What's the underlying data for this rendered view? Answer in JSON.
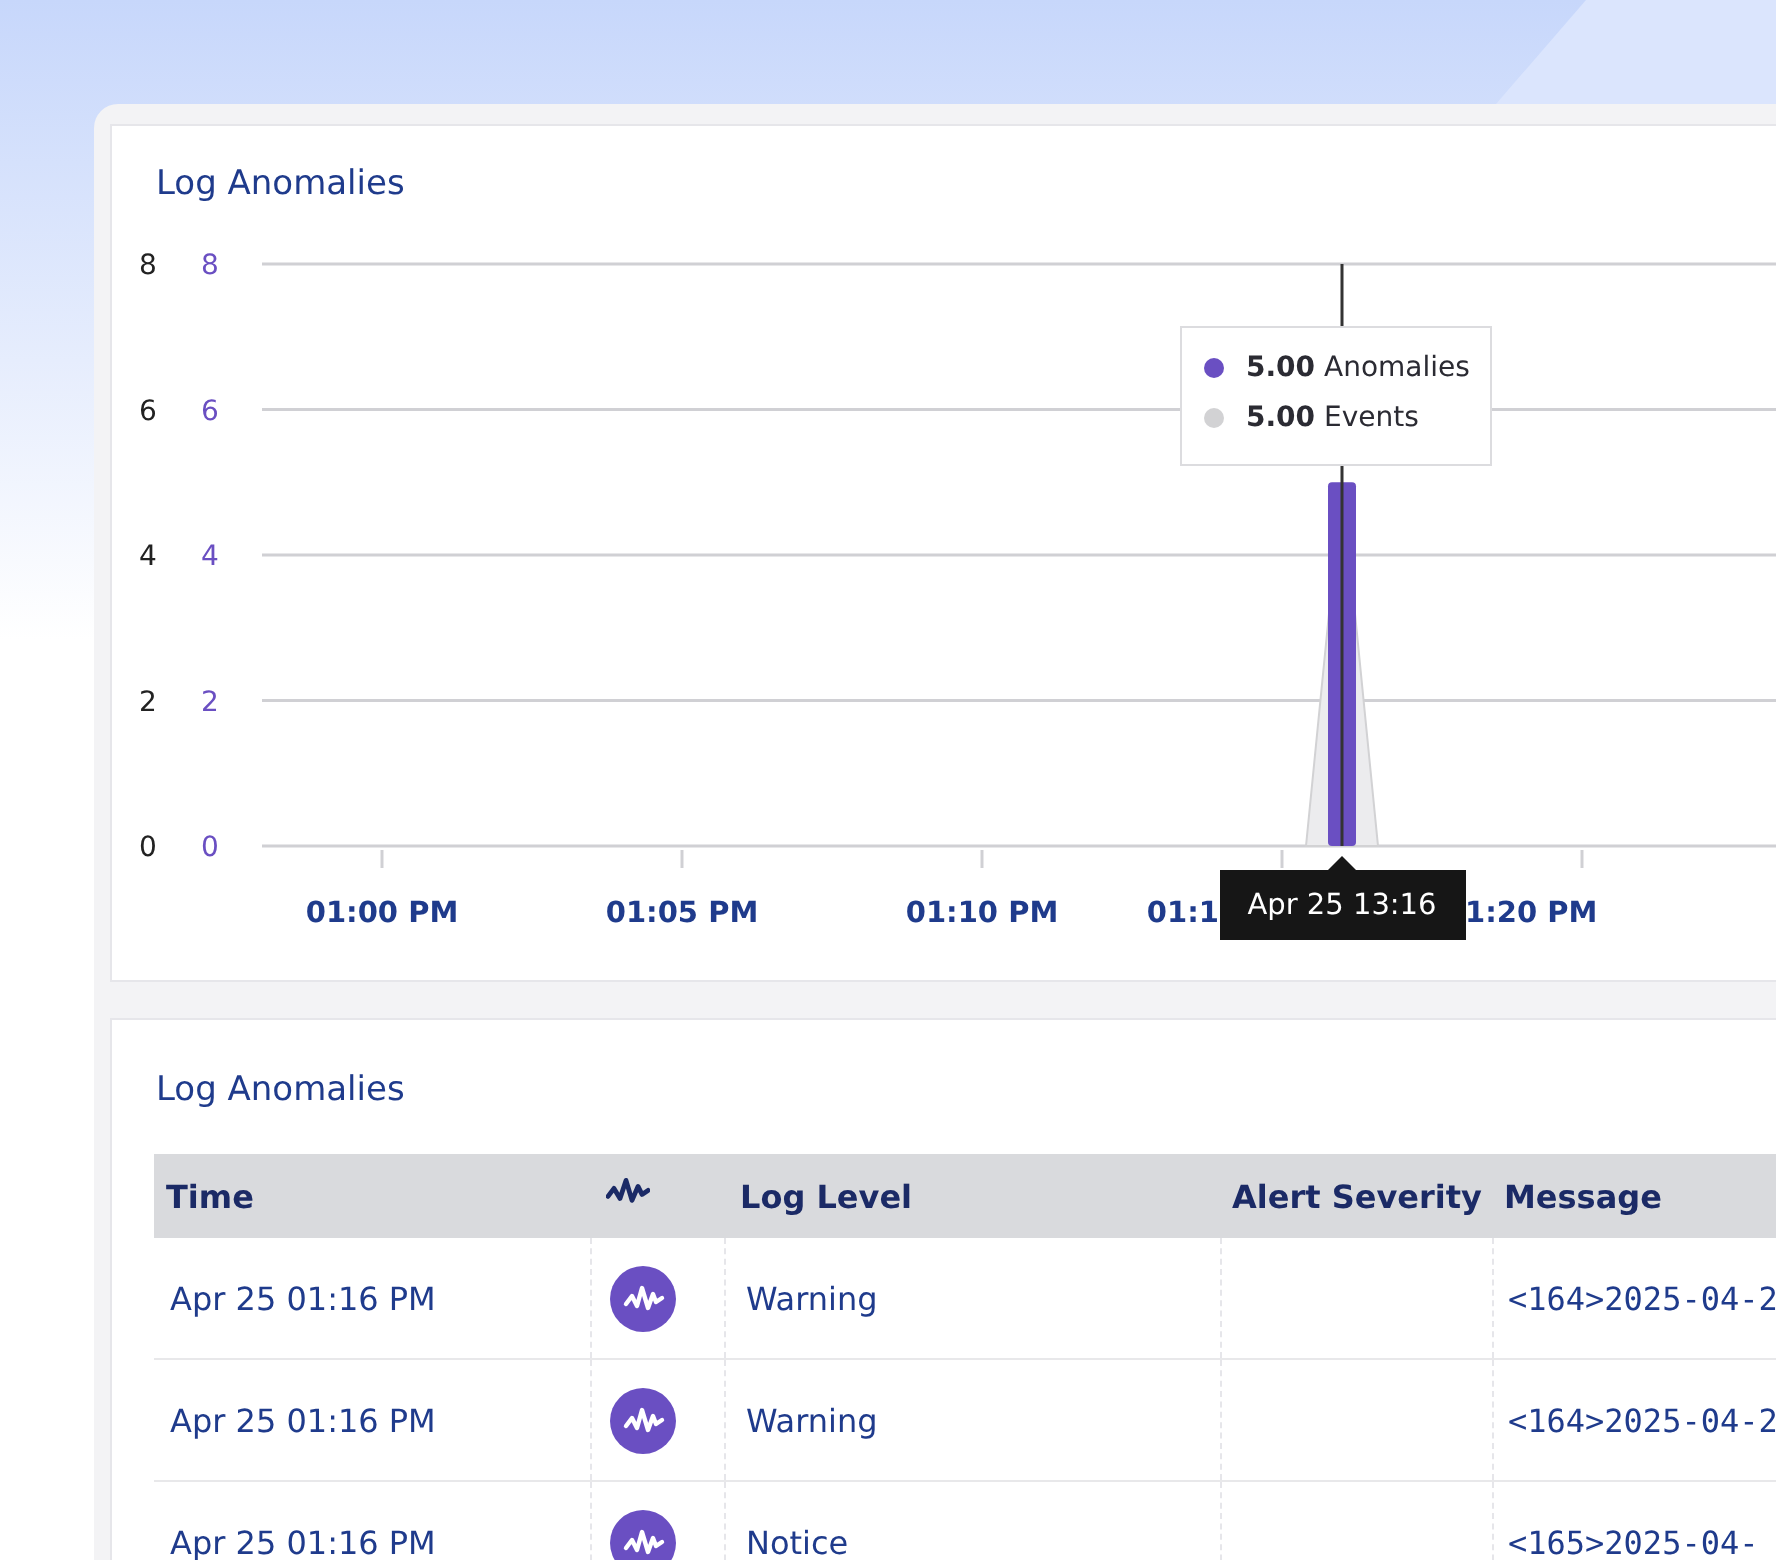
{
  "chart_panel": {
    "title": "Log Anomalies",
    "chart_data": {
      "type": "bar",
      "categories": [
        null,
        null,
        "01:00 PM",
        null,
        null,
        null,
        null,
        "01:05 PM",
        null,
        null,
        null,
        null,
        "01:10 PM",
        null,
        null,
        null,
        null,
        null,
        null,
        null,
        null,
        null,
        null,
        null,
        null,
        null
      ],
      "series": [
        {
          "name": "Anomalies",
          "color": "#6a4fc2",
          "values": [
            null,
            null,
            null,
            null,
            null,
            null,
            null,
            null,
            null,
            null,
            null,
            null,
            null,
            null,
            null,
            null,
            null,
            null,
            5,
            null,
            null,
            null,
            null,
            null,
            null,
            null
          ]
        }
      ],
      "ylim": [
        0,
        8
      ],
      "yticks": [
        0,
        2,
        4,
        6,
        8
      ],
      "grid": true
    },
    "covered_tick_labels": [
      "01:1",
      "1:20 PM"
    ],
    "events_overlay": {
      "name": "Events",
      "color": "#d2d2d4"
    },
    "outer_axis_labels": [
      "8",
      "6",
      "4",
      "2",
      "0"
    ],
    "hover_tooltip": {
      "values": [
        "5.00",
        "5.00"
      ]
    },
    "cursor_label": "Apr 25 13:16"
  },
  "table_panel": {
    "title": "Log Anomalies",
    "columns": [
      {
        "kind": "text",
        "label": "Time"
      },
      {
        "kind": "icon"
      },
      {
        "kind": "text",
        "label": "Log Level"
      },
      {
        "kind": "text",
        "label": "Alert Severity"
      },
      {
        "kind": "text",
        "label": "Message"
      }
    ],
    "rows": [
      {
        "time": "Apr 25 01:16 PM",
        "log_level": "Warning",
        "message": "<164>2025-04-2"
      },
      {
        "time": "Apr 25 01:16 PM",
        "log_level": "Warning",
        "message": "<164>2025-04-2"
      },
      {
        "time": "Apr 25 01:16 PM",
        "log_level": "Notice",
        "message": "<165>2025-04-"
      }
    ]
  }
}
